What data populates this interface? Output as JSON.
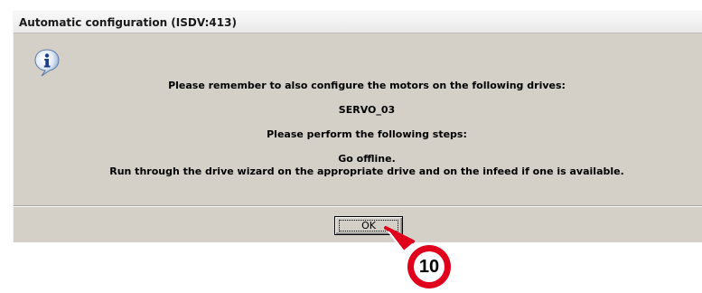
{
  "dialog": {
    "title": "Automatic configuration (ISDV:413)",
    "icon": "info-icon",
    "messages": {
      "line1": "Please remember to also configure the motors on the following drives:",
      "drive": "SERVO_03",
      "line2": "Please perform the following steps:",
      "step1": "Go offline.",
      "step2": "Run through the drive wizard on the appropriate drive and on the infeed if one is available."
    },
    "ok_label": "OK"
  },
  "callout": {
    "number": "10",
    "color": "#e0001b"
  }
}
